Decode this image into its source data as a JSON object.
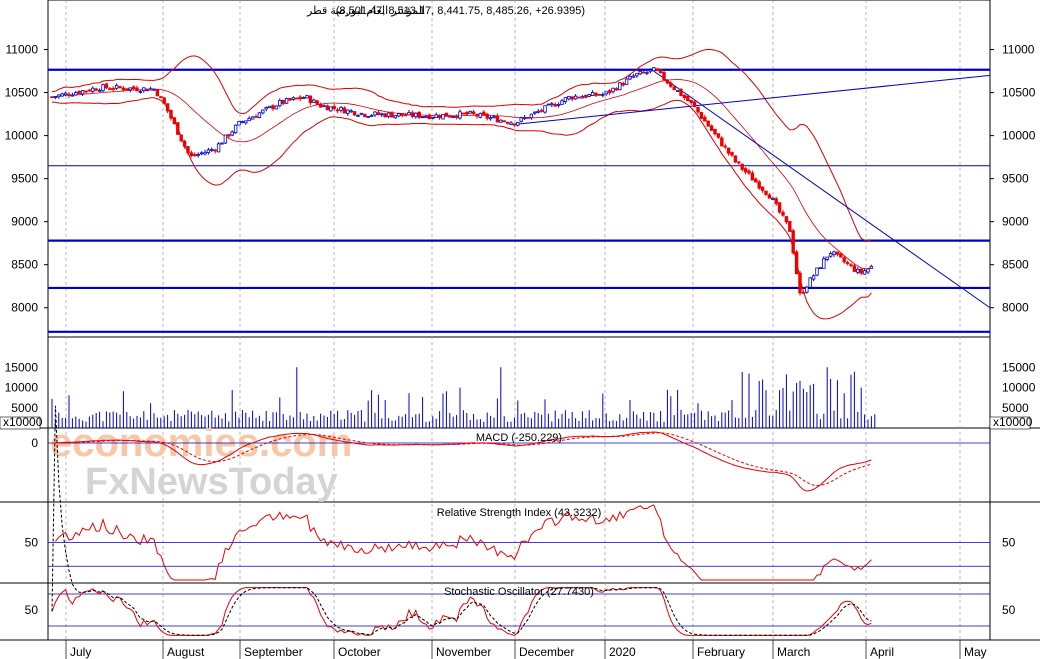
{
  "header": {
    "instrument": "المؤشر العام لبورصة قطر",
    "ohlc_text": "(8,501.47, 8,513.17, 8,441.75, 8,485.26, +26.9395)"
  },
  "panels": {
    "volume_scale_label": "x10000",
    "macd_title": "MACD (-250.229)",
    "rsi_title": "Relative Strength Index (43.3232)",
    "stoch_title": "Stochastic Oscillator (27.7430)"
  },
  "watermark": {
    "line1": "economies.com",
    "line2": "FxNewsToday"
  },
  "colors": {
    "up": "#0000cc",
    "down": "#ee0000",
    "band": "#dd0000",
    "level": "#0000cc",
    "watermark_orange": "#f7c7a6",
    "watermark_gray": "#cfcfcf"
  },
  "chart_data": [
    {
      "type": "candlestick",
      "name": "price",
      "y_ticks": [
        8000,
        8500,
        9000,
        9500,
        10000,
        10500,
        11000
      ],
      "ylim": [
        7660,
        11320
      ],
      "x_labels": [
        "July",
        "August",
        "September",
        "October",
        "November",
        "December",
        "2020",
        "February",
        "March",
        "April",
        "May"
      ],
      "horizontal_levels": [
        10765,
        9650,
        8780,
        8230,
        7720
      ],
      "trendlines": [
        {
          "from": [
            "Dec start",
            10130
          ],
          "to": [
            "May end",
            10700
          ]
        },
        {
          "from": [
            "Jan late",
            10780
          ],
          "to": [
            "May end",
            8000
          ]
        }
      ],
      "close_path": [
        [
          "Jul",
          10450
        ],
        [
          "Jul mid",
          10560
        ],
        [
          "Jul end",
          10540
        ],
        [
          "Aug start",
          10350
        ],
        [
          "Aug early",
          9750
        ],
        [
          "Aug mid",
          9850
        ],
        [
          "Sep start",
          10150
        ],
        [
          "Sep mid",
          10380
        ],
        [
          "Sep end",
          10450
        ],
        [
          "Oct start",
          10350
        ],
        [
          "Oct mid",
          10250
        ],
        [
          "Nov start",
          10230
        ],
        [
          "Nov mid",
          10250
        ],
        [
          "Dec start",
          10150
        ],
        [
          "Dec mid",
          10450
        ],
        [
          "Jan start",
          10480
        ],
        [
          "Jan mid",
          10700
        ],
        [
          "Jan late",
          10760
        ],
        [
          "Feb start",
          10350
        ],
        [
          "Feb mid",
          9700
        ],
        [
          "Feb end",
          9300
        ],
        [
          "Mar start",
          8900
        ],
        [
          "Mar early",
          8150
        ],
        [
          "Mar mid",
          8650
        ],
        [
          "Mar late",
          8400
        ],
        [
          "Apr start",
          8485
        ]
      ]
    },
    {
      "type": "bar",
      "name": "volume",
      "unit": "x10000",
      "y_ticks": [
        5000,
        10000,
        15000
      ],
      "ylim": [
        0,
        20000
      ],
      "note": "daily volume bars, peaks near 15000 in Sep, Nov and Mar"
    },
    {
      "type": "line",
      "name": "MACD",
      "current_value": -250.229,
      "y_ticks": [
        0
      ]
    },
    {
      "type": "line",
      "name": "Relative Strength Index",
      "current_value": 43.3232,
      "y_ticks": [
        50
      ]
    },
    {
      "type": "line",
      "name": "Stochastic Oscillator",
      "current_value": 27.743,
      "y_ticks": [
        50
      ]
    }
  ]
}
